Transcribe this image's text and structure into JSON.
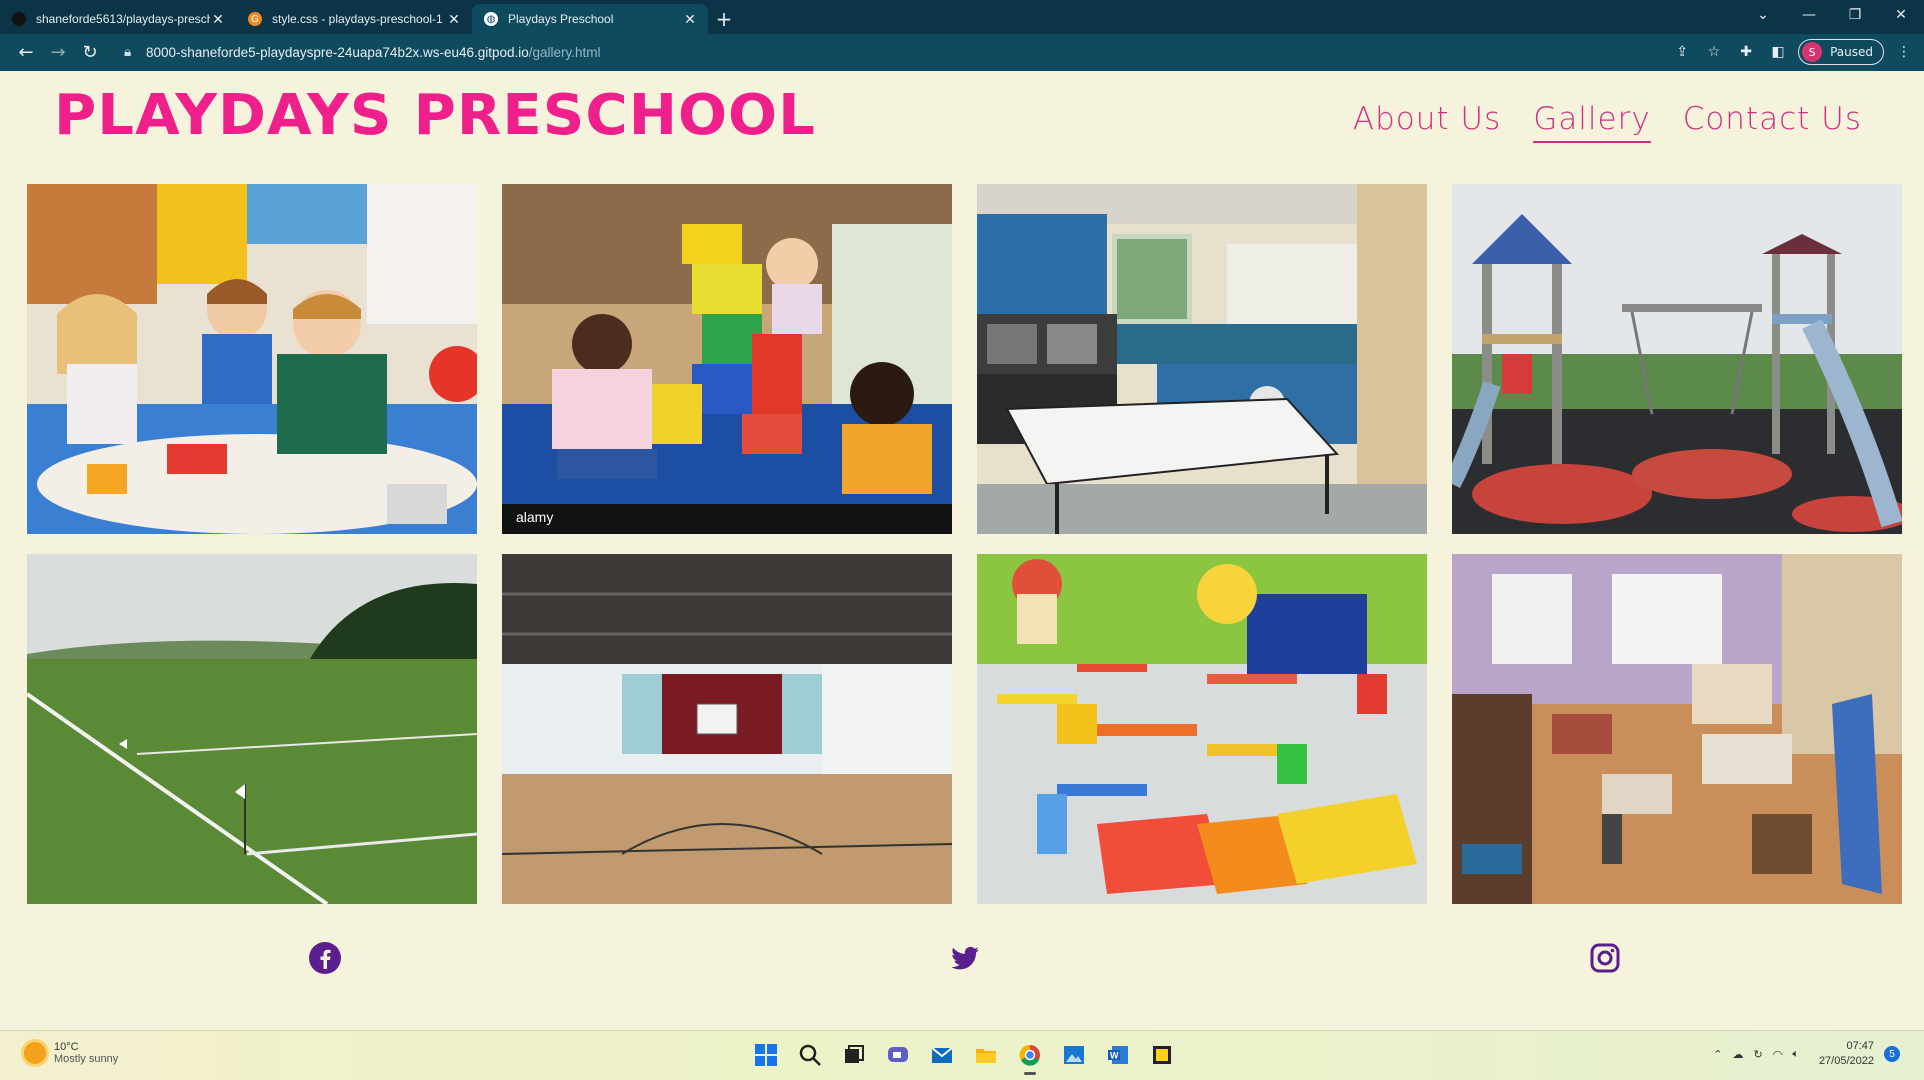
{
  "browser": {
    "tabs": [
      {
        "title": "shaneforde5613/playdays-presch",
        "active": false
      },
      {
        "title": "style.css - playdays-preschool-1",
        "active": false
      },
      {
        "title": "Playdays Preschool",
        "active": true
      }
    ],
    "url_main": "8000-shaneforde5-playdayspre-24uapa74b2x.ws-eu46.gitpod.io",
    "url_path": "/gallery.html",
    "profile_status": "Paused",
    "profile_initial": "S"
  },
  "site": {
    "brand": "PLAYDAYS PRESCHOOL",
    "nav": [
      {
        "label": "About Us",
        "active": false
      },
      {
        "label": "Gallery",
        "active": true
      },
      {
        "label": "Contact Us",
        "active": false
      }
    ],
    "gallery": [
      {
        "scene": "children-crafts-table"
      },
      {
        "scene": "children-block-tower"
      },
      {
        "scene": "kitchen"
      },
      {
        "scene": "playground"
      },
      {
        "scene": "sports-field"
      },
      {
        "scene": "sports-hall"
      },
      {
        "scene": "colorful-classroom"
      },
      {
        "scene": "playroom"
      }
    ],
    "social": [
      "facebook-icon",
      "twitter-icon",
      "instagram-icon"
    ],
    "colors": {
      "brand": "#ef1f8c",
      "nav": "#d22f82",
      "social": "#5a1e8e",
      "background": "#f6f3dd"
    }
  },
  "taskbar": {
    "temperature": "10°C",
    "weather": "Mostly sunny",
    "time": "07:47",
    "date": "27/05/2022",
    "notifications": "5"
  }
}
